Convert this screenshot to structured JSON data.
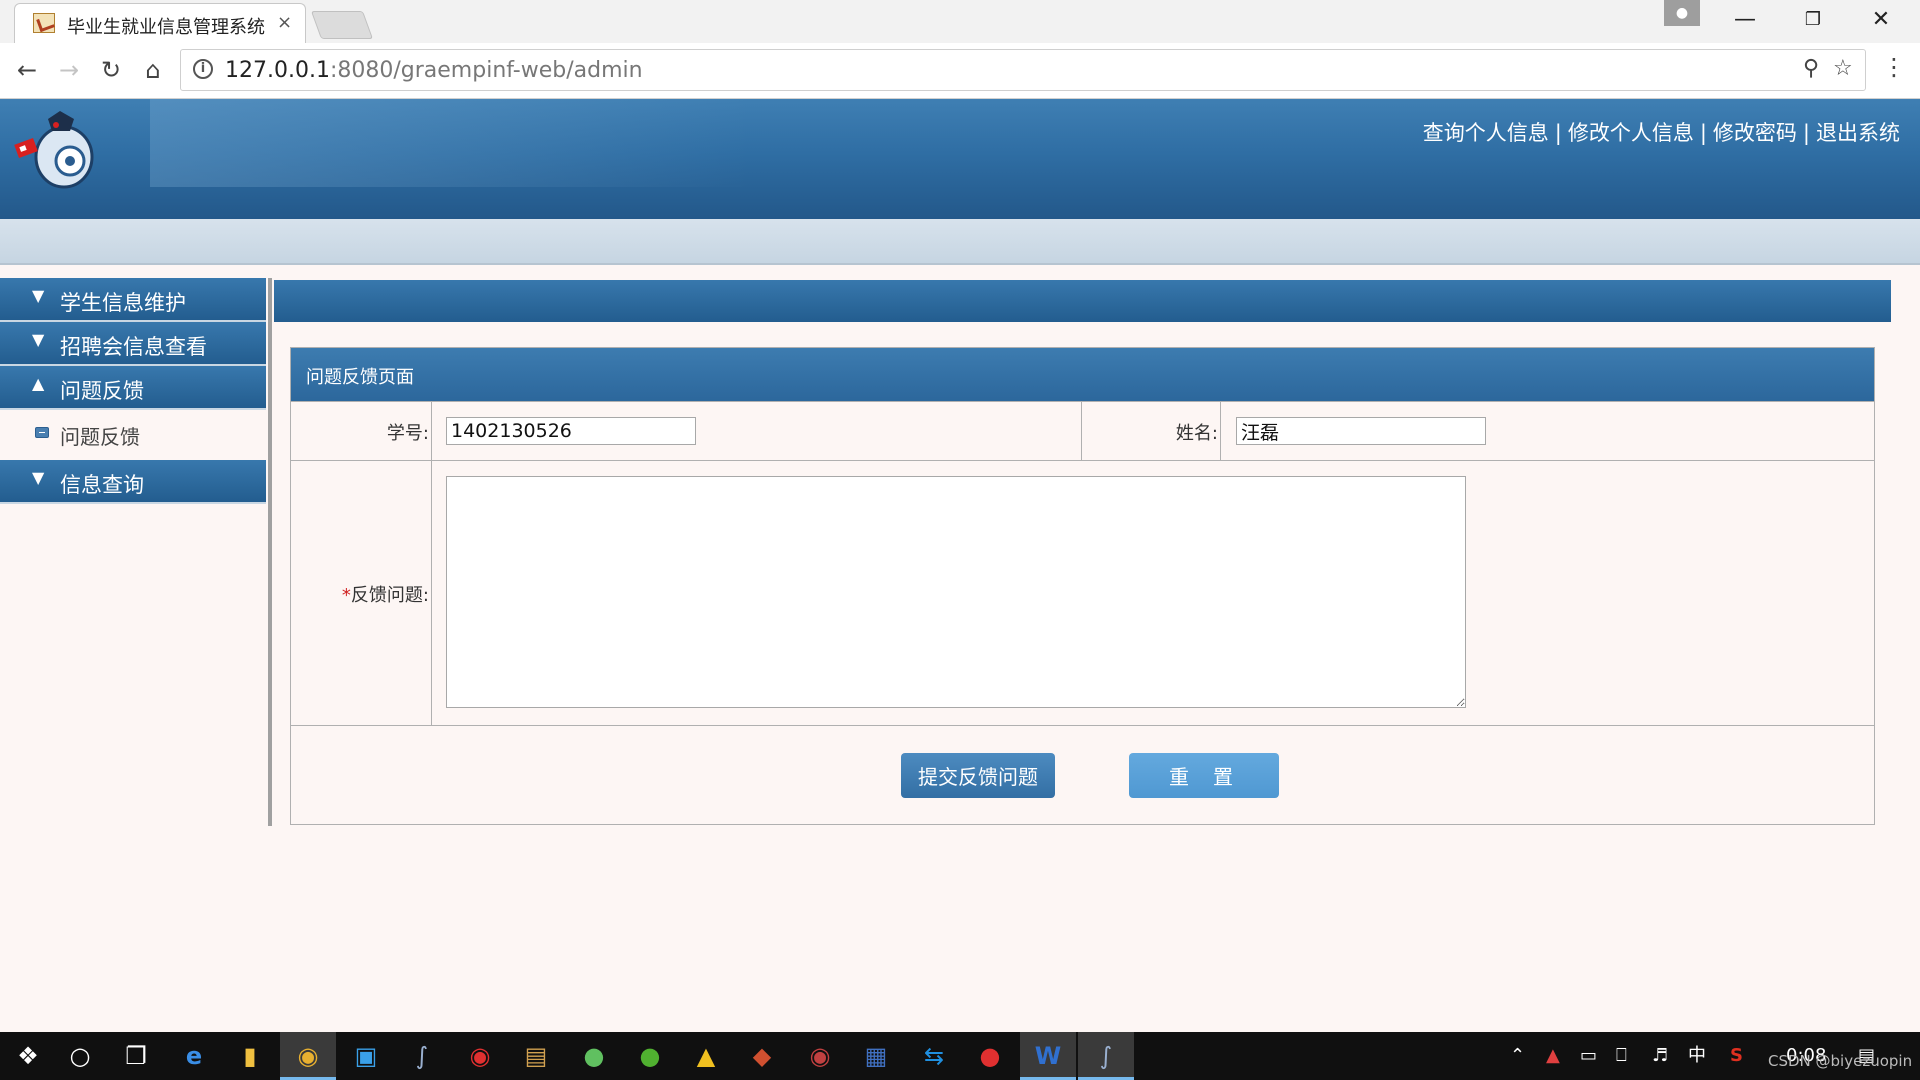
{
  "browser": {
    "tab_title": "毕业生就业信息管理系统",
    "tab_close": "×",
    "url_host": "127.0.0.1",
    "url_rest": ":8080/graempinf-web/admin"
  },
  "header": {
    "links": [
      "查询个人信息",
      "修改个人信息",
      "修改密码",
      "退出系统"
    ],
    "separator": "|"
  },
  "sidebar": {
    "sections": [
      {
        "label": "学生信息维护",
        "expanded": false
      },
      {
        "label": "招聘会信息查看",
        "expanded": false
      },
      {
        "label": "问题反馈",
        "expanded": true,
        "items": [
          {
            "label": "问题反馈"
          }
        ]
      },
      {
        "label": "信息查询",
        "expanded": false
      }
    ]
  },
  "form": {
    "panel_title": "问题反馈页面",
    "student_id_label": "学号:",
    "student_id_value": "1402130526",
    "name_label": "姓名:",
    "name_value": "汪磊",
    "required_mark": "*",
    "feedback_label": "反馈问题:",
    "feedback_value": "",
    "submit_label": "提交反馈问题",
    "reset_label": "重置"
  },
  "taskbar": {
    "ime": "中",
    "clock": "0:08"
  },
  "watermark": "CSDN @biyezuopin",
  "colors": {
    "header_blue": "#2f6ea4",
    "primary_button": "#336fa4",
    "secondary_button": "#4f98d2",
    "page_background": "#fdf6f4"
  }
}
